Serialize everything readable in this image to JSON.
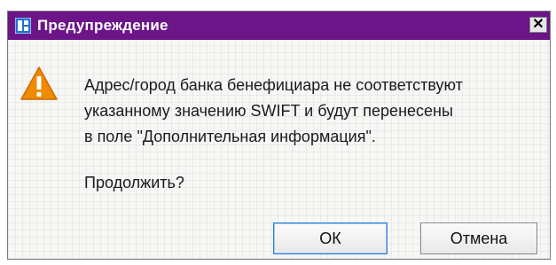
{
  "dialog": {
    "title": "Предупреждение",
    "close_label": "✕",
    "message_lines": [
      "Адрес/город банка бенефициара не соответствуют",
      "указанному значению SWIFT и будут перенесены",
      "в поле \"Дополнительная информация\"."
    ],
    "question": "Продолжить?",
    "buttons": {
      "ok": "ОК",
      "cancel": "Отмена"
    }
  },
  "colors": {
    "titlebar": "#6b1588",
    "warning": "#f08a00"
  },
  "icons": {
    "app": "app-logo-icon",
    "warning": "warning-triangle-icon"
  }
}
